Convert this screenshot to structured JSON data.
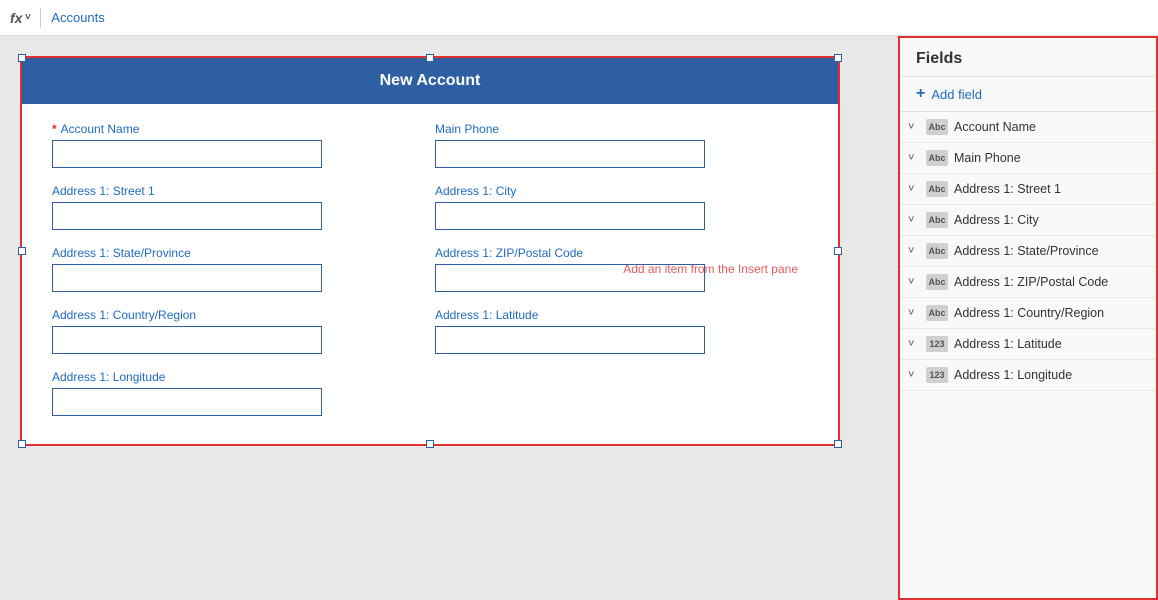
{
  "topbar": {
    "fx_label": "fx",
    "chevron": "˅",
    "breadcrumb": "Accounts"
  },
  "form": {
    "title": "New Account",
    "fields": [
      {
        "id": "account-name",
        "label": "Account Name",
        "required": true,
        "col": 1
      },
      {
        "id": "main-phone",
        "label": "Main Phone",
        "required": false,
        "col": 2
      },
      {
        "id": "address-street",
        "label": "Address 1: Street 1",
        "required": false,
        "col": 1
      },
      {
        "id": "address-city",
        "label": "Address 1: City",
        "required": false,
        "col": 2
      },
      {
        "id": "address-state",
        "label": "Address 1: State/Province",
        "required": false,
        "col": 1
      },
      {
        "id": "address-zip",
        "label": "Address 1: ZIP/Postal Code",
        "required": false,
        "col": 2
      },
      {
        "id": "address-country",
        "label": "Address 1: Country/Region",
        "required": false,
        "col": 1
      },
      {
        "id": "address-latitude",
        "label": "Address 1: Latitude",
        "required": false,
        "col": 2
      },
      {
        "id": "address-longitude",
        "label": "Address 1: Longitude",
        "required": false,
        "col": 1
      }
    ],
    "insert_hint": "Add an item from the Insert pane"
  },
  "fields_panel": {
    "title": "Fields",
    "add_field_label": "Add field",
    "items": [
      {
        "name": "Account Name",
        "type": "Abc"
      },
      {
        "name": "Main Phone",
        "type": "Abc"
      },
      {
        "name": "Address 1: Street 1",
        "type": "Abc"
      },
      {
        "name": "Address 1: City",
        "type": "Abc"
      },
      {
        "name": "Address 1: State/Province",
        "type": "Abc"
      },
      {
        "name": "Address 1: ZIP/Postal Code",
        "type": "Abc"
      },
      {
        "name": "Address 1: Country/Region",
        "type": "Abc"
      },
      {
        "name": "Address 1: Latitude",
        "type": "123"
      },
      {
        "name": "Address 1: Longitude",
        "type": "123"
      }
    ]
  }
}
